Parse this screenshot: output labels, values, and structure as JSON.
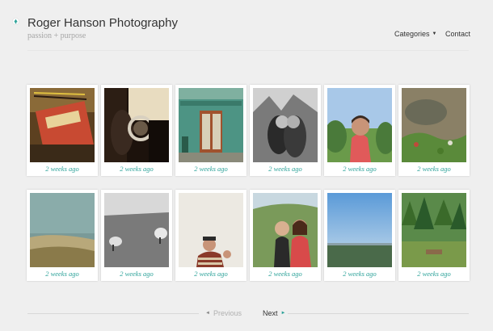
{
  "site": {
    "title": "Roger Hanson Photography",
    "tagline": "passion + purpose",
    "accent_color": "#2aa198",
    "logo_icon": "teal-pin-icon"
  },
  "nav": {
    "categories_label": "Categories",
    "categories_icon": "caret-down-icon",
    "contact_label": "Contact"
  },
  "gallery": {
    "items": [
      {
        "caption": "2 weeks ago",
        "subject": "notebook with pencils"
      },
      {
        "caption": "2 weeks ago",
        "subject": "hand holding lens"
      },
      {
        "caption": "2 weeks ago",
        "subject": "green storefront door"
      },
      {
        "caption": "2 weeks ago",
        "subject": "couple kissing black and white"
      },
      {
        "caption": "2 weeks ago",
        "subject": "woman in red shirt"
      },
      {
        "caption": "2 weeks ago",
        "subject": "puddle with plants"
      },
      {
        "caption": "2 weeks ago",
        "subject": "sea shore"
      },
      {
        "caption": "2 weeks ago",
        "subject": "sheep in field"
      },
      {
        "caption": "2 weeks ago",
        "subject": "man in striped sweater"
      },
      {
        "caption": "2 weeks ago",
        "subject": "two women on hill"
      },
      {
        "caption": "2 weeks ago",
        "subject": "sky over landscape"
      },
      {
        "caption": "2 weeks ago",
        "subject": "green forest"
      }
    ]
  },
  "pagination": {
    "previous_label": "Previous",
    "next_label": "Next"
  }
}
